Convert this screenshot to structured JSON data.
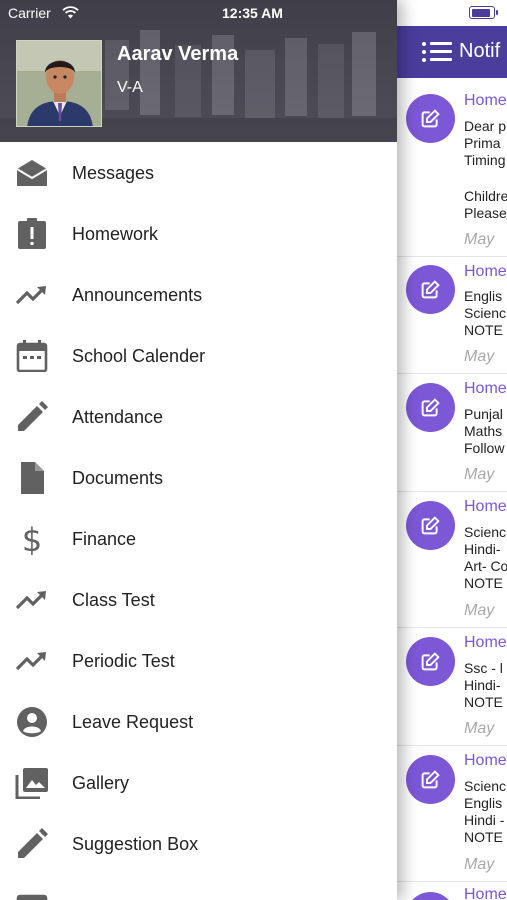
{
  "status_bar": {
    "carrier": "Carrier",
    "time": "12:35 AM"
  },
  "profile": {
    "name": "Aarav Verma",
    "class": "V-A"
  },
  "menu": {
    "items": [
      {
        "label": "Messages",
        "icon": "envelope-icon"
      },
      {
        "label": "Homework",
        "icon": "clipboard-alert-icon"
      },
      {
        "label": "Announcements",
        "icon": "trending-up-icon"
      },
      {
        "label": "School Calender",
        "icon": "calendar-icon"
      },
      {
        "label": "Attendance",
        "icon": "pencil-icon"
      },
      {
        "label": "Documents",
        "icon": "document-icon"
      },
      {
        "label": "Finance",
        "icon": "dollar-icon"
      },
      {
        "label": "Class Test",
        "icon": "trending-up-icon"
      },
      {
        "label": "Periodic Test",
        "icon": "trending-up-icon"
      },
      {
        "label": "Leave Request",
        "icon": "account-circle-icon"
      },
      {
        "label": "Gallery",
        "icon": "gallery-icon"
      },
      {
        "label": "Suggestion Box",
        "icon": "pencil-icon"
      }
    ]
  },
  "notifications": {
    "title": "Notif",
    "items": [
      {
        "title": "Home",
        "lines": [
          "Dear p",
          " Prima",
          "Timing",
          "",
          "Childre",
          "Please"
        ],
        "date": "May"
      },
      {
        "title": "Home",
        "lines": [
          "Englis",
          "Scienc",
          "NOTE"
        ],
        "date": "May"
      },
      {
        "title": "Home",
        "lines": [
          "Punjal",
          "Maths",
          "Follow"
        ],
        "date": "May"
      },
      {
        "title": "Home",
        "lines": [
          "Scienc",
          "Hindi-",
          "Art- Co",
          "NOTE"
        ],
        "date": "May"
      },
      {
        "title": "Home",
        "lines": [
          "Ssc - l",
          "Hindi-",
          "NOTE"
        ],
        "date": "May"
      },
      {
        "title": "Home",
        "lines": [
          "Scienc",
          "Englis",
          "Hindi -",
          "NOTE"
        ],
        "date": "May"
      },
      {
        "title": "Home",
        "lines": [],
        "date": ""
      }
    ]
  },
  "colors": {
    "header": "#4a3d9c",
    "accent": "#7c57d6",
    "icon_gray": "#616161"
  }
}
